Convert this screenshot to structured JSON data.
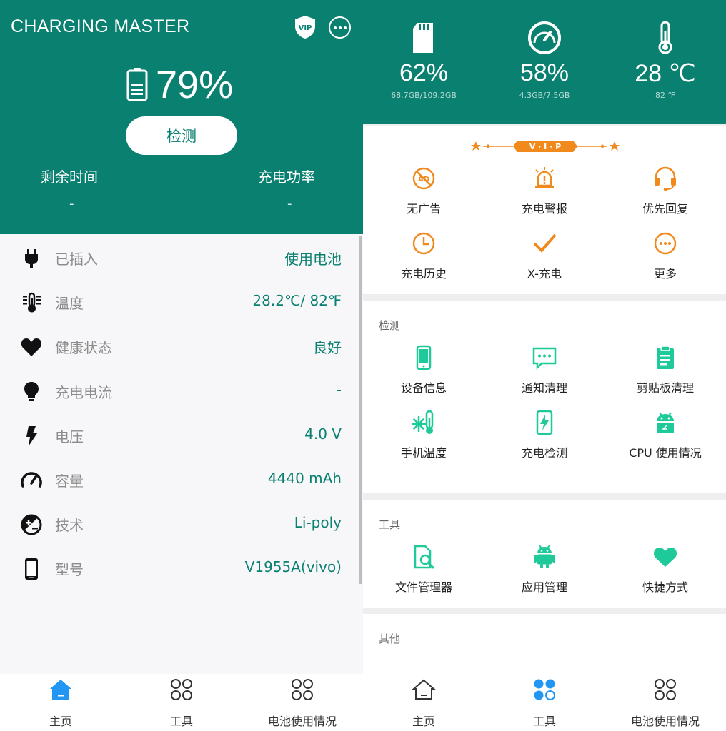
{
  "left": {
    "app_title": "CHARGING MASTER",
    "vip_icon_text": "VIP",
    "battery_percent": "79%",
    "detect_button": "检测",
    "stats": [
      {
        "label": "剩余时间",
        "value": "-"
      },
      {
        "label": "充电功率",
        "value": "-"
      }
    ],
    "info": [
      {
        "icon": "plug-icon",
        "label": "已插入",
        "value": "使用电池"
      },
      {
        "icon": "thermometer-icon",
        "label": "温度",
        "value": "28.2℃/ 82℉"
      },
      {
        "icon": "heart-icon",
        "label": "健康状态",
        "value": "良好"
      },
      {
        "icon": "lightbulb-icon",
        "label": "充电电流",
        "value": "-"
      },
      {
        "icon": "bolt-icon",
        "label": "电压",
        "value": "4.0 V"
      },
      {
        "icon": "gauge-icon",
        "label": "容量",
        "value": "4440 mAh"
      },
      {
        "icon": "plus-minus-icon",
        "label": "技术",
        "value": "Li-poly"
      },
      {
        "icon": "phone-icon",
        "label": "型号",
        "value": "V1955A(vivo)"
      }
    ],
    "nav": [
      {
        "label": "主页",
        "active": true
      },
      {
        "label": "工具",
        "active": false
      },
      {
        "label": "电池使用情况",
        "active": false
      }
    ]
  },
  "right": {
    "metrics": [
      {
        "icon": "sd-card-icon",
        "value": "62%",
        "sub": "68.7GB/109.2GB"
      },
      {
        "icon": "speedometer-icon",
        "value": "58%",
        "sub": "4.3GB/7.5GB"
      },
      {
        "icon": "thermometer-icon",
        "value": "28 ℃",
        "sub": "82 ℉"
      }
    ],
    "vip_label": "V · I · P",
    "vip_items": [
      "无广告",
      "充电警报",
      "优先回复",
      "充电历史",
      "X-充电",
      "更多"
    ],
    "detect_title": "检测",
    "detect_items": [
      "设备信息",
      "通知清理",
      "剪贴板清理",
      "手机温度",
      "充电检测",
      "CPU 使用情况"
    ],
    "tools_title": "工具",
    "tools_items": [
      "文件管理器",
      "应用管理",
      "快捷方式"
    ],
    "other_title": "其他",
    "nav": [
      {
        "label": "主页",
        "active": false
      },
      {
        "label": "工具",
        "active": true
      },
      {
        "label": "电池使用情况",
        "active": false
      }
    ]
  },
  "colors": {
    "primary": "#0a8070",
    "vip_orange": "#f08a1c",
    "accent_green": "#1ec99a",
    "nav_active": "#2196f3"
  }
}
